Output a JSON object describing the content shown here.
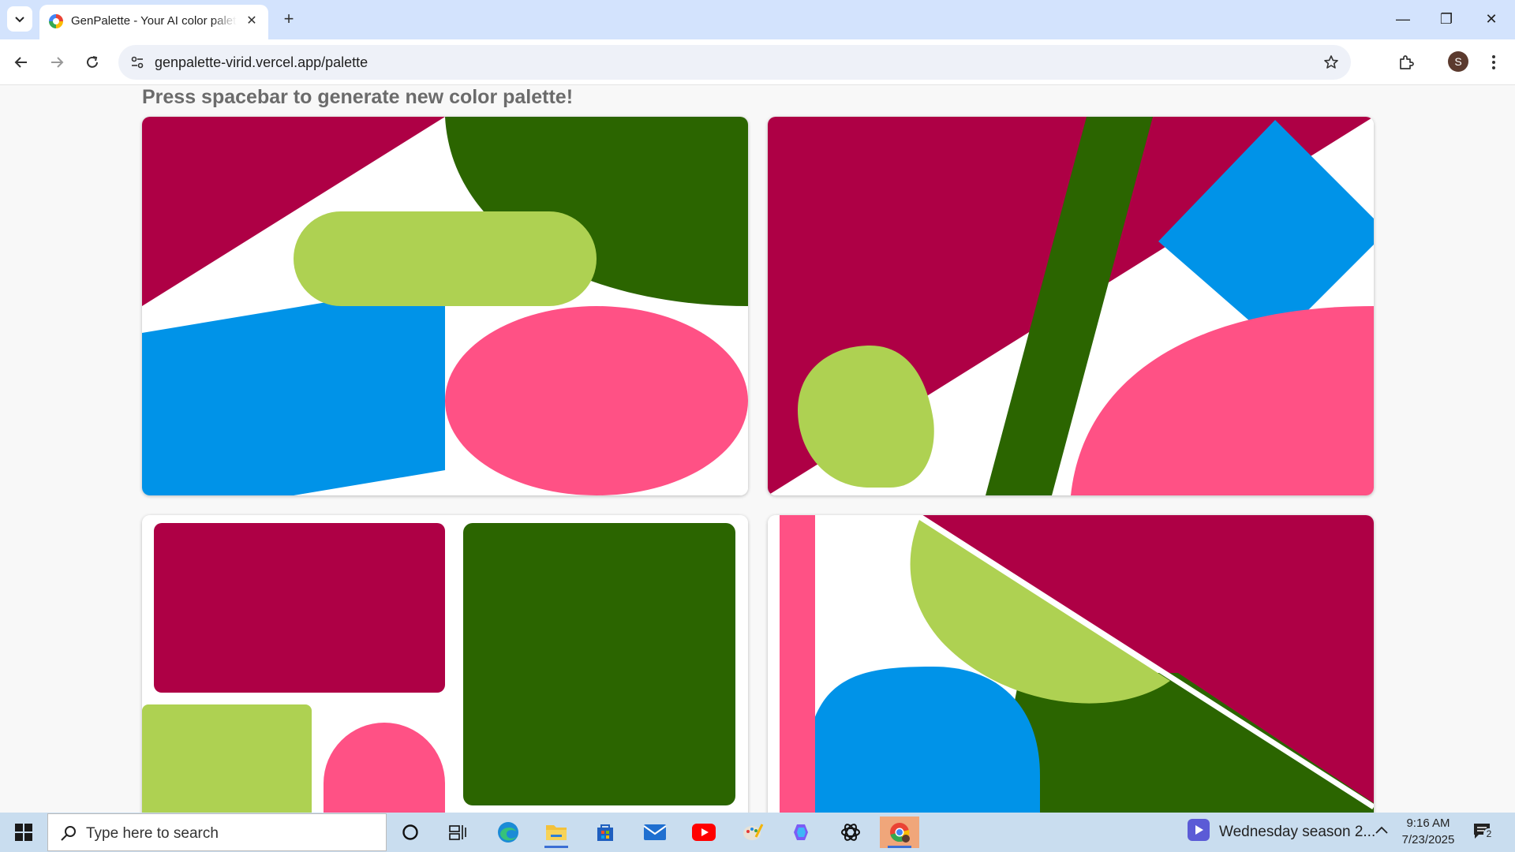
{
  "browser": {
    "tab_title": "GenPalette - Your AI color palette generator",
    "tab_close": "✕",
    "new_tab": "+",
    "url": "genpalette-virid.vercel.app/palette",
    "profile_initial": "S",
    "window_controls": {
      "minimize": "—",
      "restore": "❐",
      "close": "✕"
    }
  },
  "page": {
    "headline": "Press spacebar to generate new color palette!"
  },
  "palette": {
    "colors": [
      "#ae0045",
      "#2b6500",
      "#aed152",
      "#0093e8",
      "#ff5185",
      "#ffffff"
    ]
  },
  "taskbar": {
    "search_placeholder": "Type here to search",
    "media_text": "Wednesday season 2...",
    "time": "9:16 AM",
    "date": "7/23/2025",
    "notification_count": "2",
    "apps": [
      "cortana-icon",
      "task-view-icon",
      "edge-icon",
      "file-explorer-icon",
      "store-icon",
      "mail-icon",
      "youtube-icon",
      "paint-icon",
      "copilot-icon",
      "chatgpt-icon",
      "chrome-icon"
    ]
  }
}
